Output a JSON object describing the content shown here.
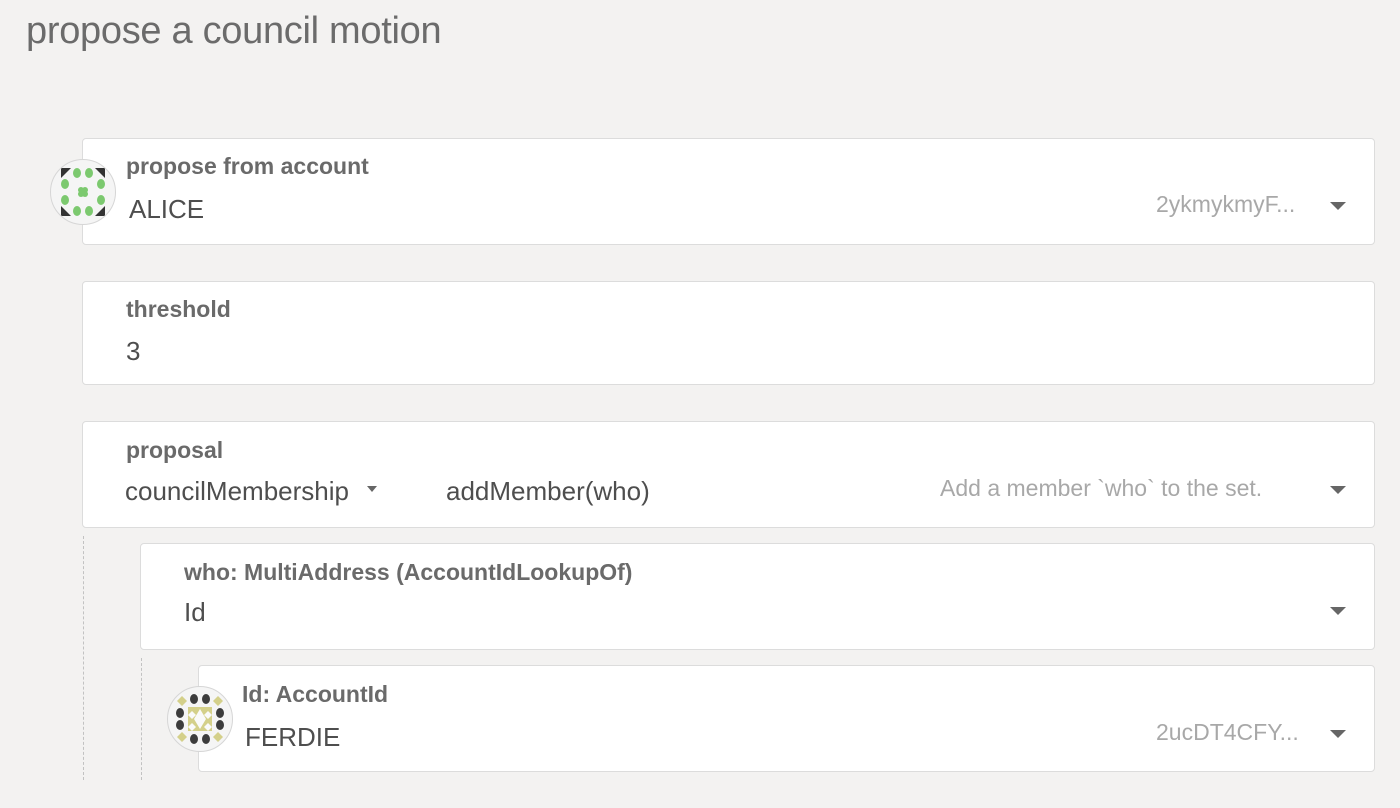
{
  "page": {
    "title": "propose a council motion"
  },
  "account": {
    "label": "propose from account",
    "name": "ALICE",
    "address": "2ykmykmyF..."
  },
  "threshold": {
    "label": "threshold",
    "value": "3"
  },
  "proposal": {
    "label": "proposal",
    "section": "councilMembership",
    "method": "addMember(who)",
    "description": "Add a member `who` to the set."
  },
  "who": {
    "label": "who: MultiAddress (AccountIdLookupOf)",
    "value": "Id"
  },
  "account_id": {
    "label": "Id: AccountId",
    "name": "FERDIE",
    "address": "2ucDT4CFY..."
  },
  "icons": {
    "account_identicon": "identicon-green",
    "account_id_identicon": "identicon-olive",
    "dropdown": "chevron-down-icon"
  },
  "colors": {
    "background": "#f3f2f1",
    "identicon_green": "#7cc96f",
    "identicon_olive": "#d4d08a",
    "identicon_dark": "#3c3c3c"
  }
}
